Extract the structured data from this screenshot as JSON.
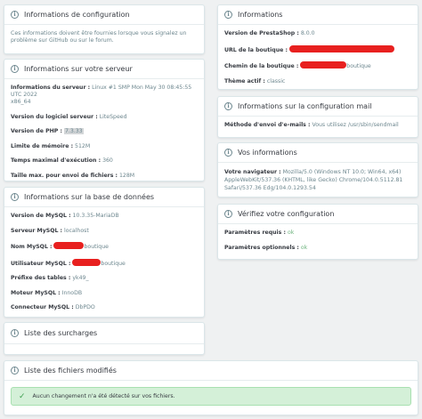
{
  "config": {
    "title": "Informations de configuration",
    "description": "Ces informations doivent être fournies lorsque vous signalez un problème sur GitHub ou sur le forum."
  },
  "server": {
    "title": "Informations sur votre serveur",
    "rows": {
      "info_label": "Informations du serveur :",
      "info_value": "Linux #1 SMP Mon May 30 08:45:55 UTC 2022",
      "info_value2": "x86_64",
      "software_label": "Version du logiciel serveur :",
      "software_value": "LiteSpeed",
      "php_label": "Version de PHP :",
      "php_value": "7.3.33",
      "memory_label": "Limite de mémoire :",
      "memory_value": "512M",
      "exec_label": "Temps maximal d'exécution :",
      "exec_value": "360",
      "upload_label": "Taille max. pour envoi de fichiers :",
      "upload_value": "128M"
    }
  },
  "database": {
    "title": "Informations sur la base de données",
    "rows": {
      "mysql_version_label": "Version de MySQL :",
      "mysql_version_value": "10.3.35-MariaDB",
      "server_label": "Serveur MySQL :",
      "server_value": "localhost",
      "name_label": "Nom MySQL :",
      "name_suffix": "boutique",
      "user_label": "Utilisateur MySQL :",
      "user_suffix": "boutique",
      "prefix_label": "Préfixe des tables :",
      "prefix_value": "yk49_",
      "engine_label": "Moteur MySQL :",
      "engine_value": "InnoDB",
      "driver_label": "Connecteur MySQL :",
      "driver_value": "DbPDO"
    }
  },
  "overrides": {
    "title": "Liste des surcharges"
  },
  "modified": {
    "title": "Liste des fichiers modifiés",
    "success": "Aucun changement n'a été détecté sur vos fichiers."
  },
  "info": {
    "title": "Informations",
    "rows": {
      "version_label": "Version de PrestaShop :",
      "version_value": "8.0.0",
      "url_label": "URL de la boutique :",
      "path_label": "Chemin de la boutique :",
      "path_suffix": "boutique",
      "theme_label": "Thème actif :",
      "theme_value": "classic"
    }
  },
  "mail": {
    "title": "Informations sur la configuration mail",
    "method_label": "Méthode d'envoi d'e-mails :",
    "method_value": "Vous utilisez /usr/sbin/sendmail"
  },
  "client": {
    "title": "Vos informations",
    "browser_label": "Votre navigateur :",
    "browser_value1": "Mozilla/5.0 (Windows NT 10.0; Win64, x64)",
    "browser_value2": "AppleWebKit/537.36 (KHTML, like Gecko) Chrome/104.0.5112.81",
    "browser_value3": "Safari/537.36 Edg/104.0.1293.54"
  },
  "check": {
    "title": "Vérifiez votre configuration",
    "required_label": "Paramètres requis :",
    "required_value": "ok",
    "optional_label": "Paramètres optionnels :",
    "optional_value": "ok"
  },
  "colors": {
    "background": "#eff1f2",
    "redaction": "#e8201f",
    "ok": "#70b580",
    "success_bg": "#d4f0d8"
  }
}
